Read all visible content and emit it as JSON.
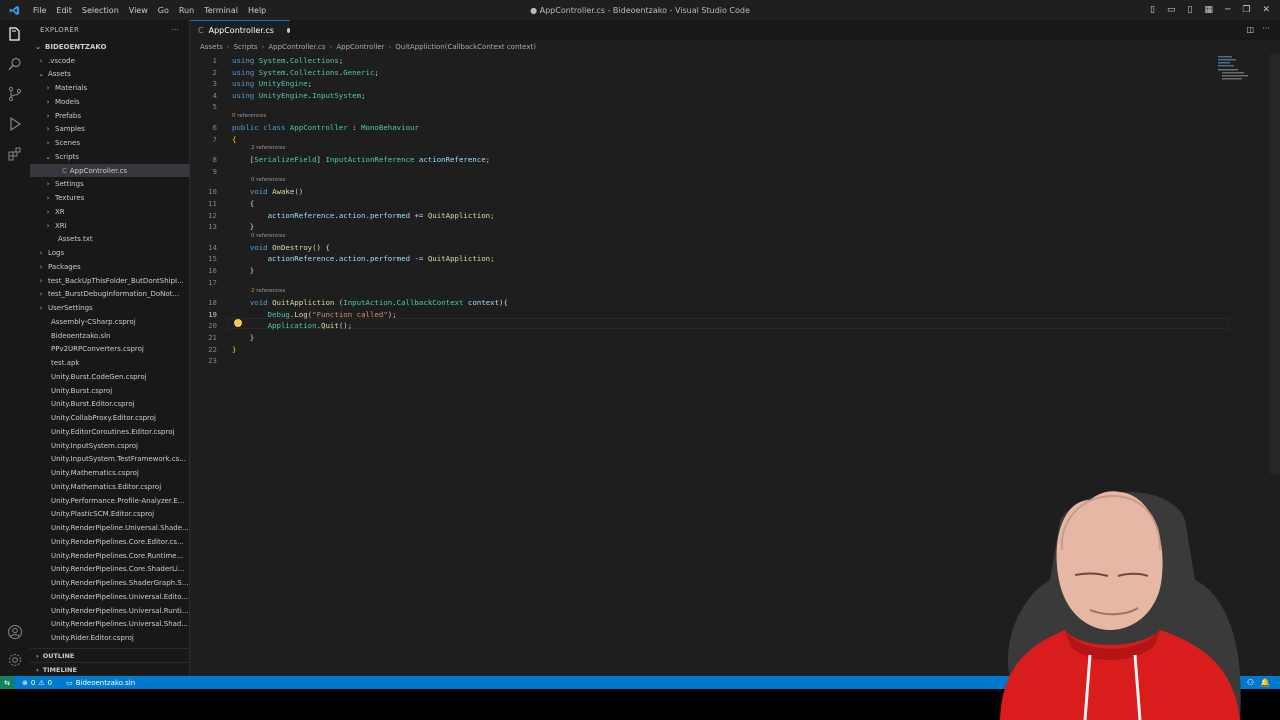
{
  "titlebar": {
    "menu": [
      "File",
      "Edit",
      "Selection",
      "View",
      "Go",
      "Run",
      "Terminal",
      "Help"
    ],
    "title": "● AppController.cs - Bideoentzako - Visual Studio Code"
  },
  "sidebar": {
    "header": "EXPLORER",
    "root": "BIDEOENTZAKO",
    "items": [
      {
        "label": ".vscode",
        "indent": 1,
        "kind": "folder",
        "open": false
      },
      {
        "label": "Assets",
        "indent": 1,
        "kind": "folder",
        "open": true
      },
      {
        "label": "Materials",
        "indent": 2,
        "kind": "folder",
        "open": false
      },
      {
        "label": "Models",
        "indent": 2,
        "kind": "folder",
        "open": false
      },
      {
        "label": "Prefabs",
        "indent": 2,
        "kind": "folder",
        "open": false
      },
      {
        "label": "Samples",
        "indent": 2,
        "kind": "folder",
        "open": false
      },
      {
        "label": "Scenes",
        "indent": 2,
        "kind": "folder",
        "open": false
      },
      {
        "label": "Scripts",
        "indent": 2,
        "kind": "folder",
        "open": true
      },
      {
        "label": "AppController.cs",
        "indent": 3,
        "kind": "file",
        "selected": true
      },
      {
        "label": "Settings",
        "indent": 2,
        "kind": "folder",
        "open": false
      },
      {
        "label": "Textures",
        "indent": 2,
        "kind": "folder",
        "open": false
      },
      {
        "label": "XR",
        "indent": 2,
        "kind": "folder",
        "open": false
      },
      {
        "label": "XRI",
        "indent": 2,
        "kind": "folder",
        "open": false
      },
      {
        "label": "Assets.txt",
        "indent": 2,
        "kind": "file"
      },
      {
        "label": "Logs",
        "indent": 1,
        "kind": "folder",
        "open": false
      },
      {
        "label": "Packages",
        "indent": 1,
        "kind": "folder",
        "open": false
      },
      {
        "label": "test_BackUpThisFolder_ButDontShipI...",
        "indent": 1,
        "kind": "folder",
        "open": false
      },
      {
        "label": "test_BurstDebugInformation_DoNot...",
        "indent": 1,
        "kind": "folder",
        "open": false
      },
      {
        "label": "UserSettings",
        "indent": 1,
        "kind": "folder",
        "open": false
      },
      {
        "label": "Assembly-CSharp.csproj",
        "indent": 1,
        "kind": "file"
      },
      {
        "label": "Bideoentzako.sln",
        "indent": 1,
        "kind": "file"
      },
      {
        "label": "PPv2URPConverters.csproj",
        "indent": 1,
        "kind": "file"
      },
      {
        "label": "test.apk",
        "indent": 1,
        "kind": "file"
      },
      {
        "label": "Unity.Burst.CodeGen.csproj",
        "indent": 1,
        "kind": "file"
      },
      {
        "label": "Unity.Burst.csproj",
        "indent": 1,
        "kind": "file"
      },
      {
        "label": "Unity.Burst.Editor.csproj",
        "indent": 1,
        "kind": "file"
      },
      {
        "label": "Unity.CollabProxy.Editor.csproj",
        "indent": 1,
        "kind": "file"
      },
      {
        "label": "Unity.EditorCoroutines.Editor.csproj",
        "indent": 1,
        "kind": "file"
      },
      {
        "label": "Unity.InputSystem.csproj",
        "indent": 1,
        "kind": "file"
      },
      {
        "label": "Unity.InputSystem.TestFramework.cs...",
        "indent": 1,
        "kind": "file"
      },
      {
        "label": "Unity.Mathematics.csproj",
        "indent": 1,
        "kind": "file"
      },
      {
        "label": "Unity.Mathematics.Editor.csproj",
        "indent": 1,
        "kind": "file"
      },
      {
        "label": "Unity.Performance.Profile-Analyzer.E...",
        "indent": 1,
        "kind": "file"
      },
      {
        "label": "Unity.PlasticSCM.Editor.csproj",
        "indent": 1,
        "kind": "file"
      },
      {
        "label": "Unity.RenderPipeline.Universal.Shade...",
        "indent": 1,
        "kind": "file"
      },
      {
        "label": "Unity.RenderPipelines.Core.Editor.cs...",
        "indent": 1,
        "kind": "file"
      },
      {
        "label": "Unity.RenderPipelines.Core.Runtime...",
        "indent": 1,
        "kind": "file"
      },
      {
        "label": "Unity.RenderPipelines.Core.ShaderLi...",
        "indent": 1,
        "kind": "file"
      },
      {
        "label": "Unity.RenderPipelines.ShaderGraph.S...",
        "indent": 1,
        "kind": "file"
      },
      {
        "label": "Unity.RenderPipelines.Universal.Edito...",
        "indent": 1,
        "kind": "file"
      },
      {
        "label": "Unity.RenderPipelines.Universal.Runti...",
        "indent": 1,
        "kind": "file"
      },
      {
        "label": "Unity.RenderPipelines.Universal.Shad...",
        "indent": 1,
        "kind": "file"
      },
      {
        "label": "Unity.Rider.Editor.csproj",
        "indent": 1,
        "kind": "file"
      }
    ],
    "outline": "OUTLINE",
    "timeline": "TIMELINE"
  },
  "editor": {
    "tab_label": "AppController.cs",
    "breadcrumbs": [
      "Assets",
      "Scripts",
      "AppController.cs",
      "AppController",
      "QuitAppliction(CallbackContext context)"
    ],
    "lines": [
      {
        "n": "1",
        "segs": [
          [
            "kw",
            "using "
          ],
          [
            "ty",
            "System"
          ],
          [
            "",
            "."
          ],
          [
            "ty",
            "Collections"
          ],
          [
            "",
            ";"
          ]
        ]
      },
      {
        "n": "2",
        "segs": [
          [
            "kw",
            "using "
          ],
          [
            "ty",
            "System"
          ],
          [
            "",
            "."
          ],
          [
            "ty",
            "Collections"
          ],
          [
            "",
            "."
          ],
          [
            "ty",
            "Generic"
          ],
          [
            "",
            ";"
          ]
        ]
      },
      {
        "n": "3",
        "segs": [
          [
            "kw",
            "using "
          ],
          [
            "ty",
            "UnityEngine"
          ],
          [
            "",
            ";"
          ]
        ]
      },
      {
        "n": "4",
        "segs": [
          [
            "kw",
            "using "
          ],
          [
            "ty",
            "UnityEngine"
          ],
          [
            "",
            "."
          ],
          [
            "ty",
            "InputSystem"
          ],
          [
            "",
            ";"
          ]
        ]
      },
      {
        "n": "5",
        "segs": []
      },
      {
        "n": "6",
        "lens": "0 references",
        "segs": [
          [
            "kw",
            "public class "
          ],
          [
            "ty",
            "AppController"
          ],
          [
            "",
            " : "
          ],
          [
            "ty",
            "MonoBehaviour"
          ]
        ]
      },
      {
        "n": "7",
        "segs": [
          [
            "br",
            "{"
          ]
        ]
      },
      {
        "n": "8",
        "lens": "2 references",
        "segs": [
          [
            "",
            "    ["
          ],
          [
            "ty",
            "SerializeField"
          ],
          [
            "",
            "] "
          ],
          [
            "ty",
            "InputActionReference"
          ],
          [
            "",
            " "
          ],
          [
            "vr",
            "actionReference"
          ],
          [
            "",
            ";"
          ]
        ]
      },
      {
        "n": "9",
        "segs": []
      },
      {
        "n": "10",
        "lens": "0 references",
        "segs": [
          [
            "",
            "    "
          ],
          [
            "kw",
            "void "
          ],
          [
            "fn",
            "Awake"
          ],
          [
            "",
            "()"
          ]
        ]
      },
      {
        "n": "11",
        "segs": [
          [
            "",
            "    {"
          ]
        ]
      },
      {
        "n": "12",
        "segs": [
          [
            "",
            "        "
          ],
          [
            "vr",
            "actionReference"
          ],
          [
            "",
            "."
          ],
          [
            "vr",
            "action"
          ],
          [
            "",
            "."
          ],
          [
            "vr",
            "performed"
          ],
          [
            "",
            " += "
          ],
          [
            "fn",
            "QuitAppliction"
          ],
          [
            "",
            ";"
          ]
        ]
      },
      {
        "n": "13",
        "segs": [
          [
            "",
            "    }"
          ]
        ]
      },
      {
        "n": "14",
        "lens": "0 references",
        "segs": [
          [
            "",
            "    "
          ],
          [
            "kw",
            "void "
          ],
          [
            "fn",
            "OnDestroy"
          ],
          [
            "",
            "() {"
          ]
        ]
      },
      {
        "n": "15",
        "segs": [
          [
            "",
            "        "
          ],
          [
            "vr",
            "actionReference"
          ],
          [
            "",
            "."
          ],
          [
            "vr",
            "action"
          ],
          [
            "",
            "."
          ],
          [
            "vr",
            "performed"
          ],
          [
            "",
            " -= "
          ],
          [
            "fn",
            "QuitAppliction"
          ],
          [
            "",
            ";"
          ]
        ]
      },
      {
        "n": "16",
        "segs": [
          [
            "",
            "    }"
          ]
        ]
      },
      {
        "n": "17",
        "segs": []
      },
      {
        "n": "18",
        "lens": "2 references",
        "segs": [
          [
            "",
            "    "
          ],
          [
            "kw",
            "void "
          ],
          [
            "fn",
            "QuitAppliction"
          ],
          [
            "",
            " ("
          ],
          [
            "ty",
            "InputAction"
          ],
          [
            "",
            "."
          ],
          [
            "ty",
            "CallbackContext"
          ],
          [
            "",
            " "
          ],
          [
            "vr",
            "context"
          ],
          [
            "",
            "){"
          ]
        ]
      },
      {
        "n": "19",
        "active": true,
        "segs": [
          [
            "",
            "        "
          ],
          [
            "ty",
            "Debug"
          ],
          [
            "",
            "."
          ],
          [
            "fn",
            "Log"
          ],
          [
            "",
            "("
          ],
          [
            "st",
            "\"Function called\""
          ],
          [
            "",
            ");"
          ]
        ]
      },
      {
        "n": "20",
        "segs": [
          [
            "",
            "        "
          ],
          [
            "ty",
            "Application"
          ],
          [
            "",
            "."
          ],
          [
            "fn",
            "Quit"
          ],
          [
            "",
            "();"
          ]
        ]
      },
      {
        "n": "21",
        "segs": [
          [
            "",
            "    }"
          ]
        ]
      },
      {
        "n": "22",
        "segs": [
          [
            "br",
            "}"
          ]
        ]
      },
      {
        "n": "23",
        "segs": []
      }
    ]
  },
  "statusbar": {
    "errors": "0",
    "warnings": "0",
    "solution": "Bideoentzako.sln"
  },
  "colors": {
    "accent": "#007acc",
    "editor_bg": "#1e1e1e",
    "sidebar_bg": "#181818"
  }
}
